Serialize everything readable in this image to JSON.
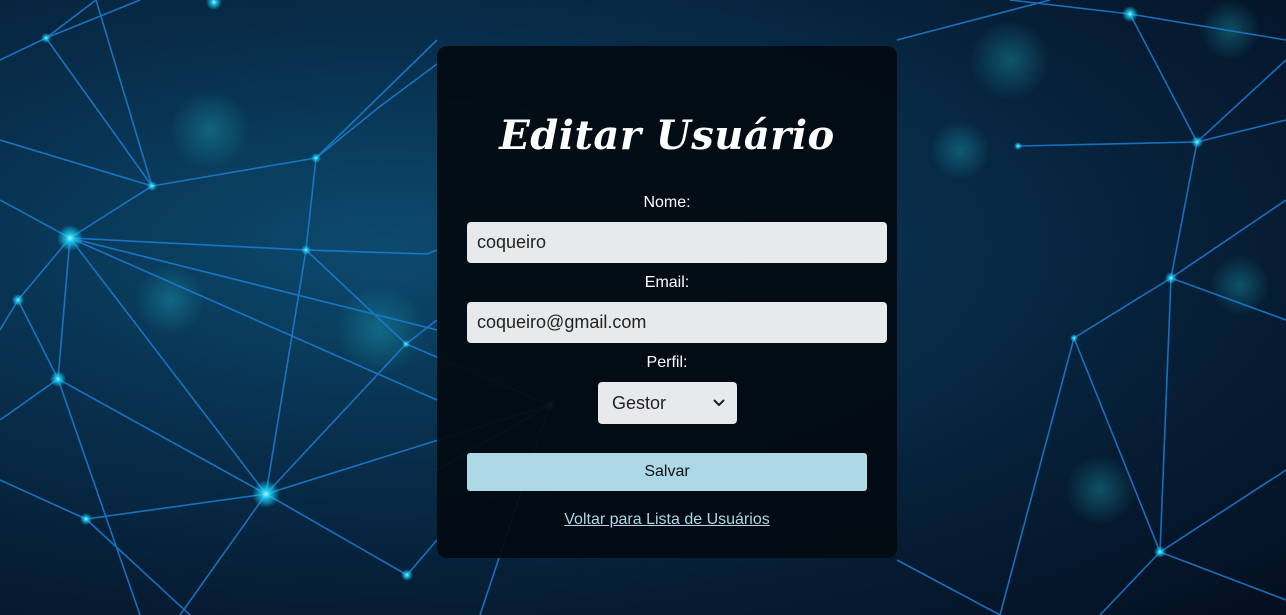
{
  "page": {
    "title": "Editar Usuário"
  },
  "form": {
    "nome_label": "Nome:",
    "nome_value": "coqueiro",
    "email_label": "Email:",
    "email_value": "coqueiro@gmail.com",
    "perfil_label": "Perfil:",
    "perfil_selected": "Gestor",
    "save_label": "Salvar",
    "back_link": "Voltar para Lista de Usuários"
  },
  "theme": {
    "card_bg": "#02090f",
    "input_bg": "#e8e9eb",
    "button_bg": "#add8e6",
    "link_color": "#add8e6",
    "network_line": "#1a7fd6",
    "network_node": "#19d6ff"
  },
  "icons": {
    "select_arrow": "chevron-down-icon"
  }
}
